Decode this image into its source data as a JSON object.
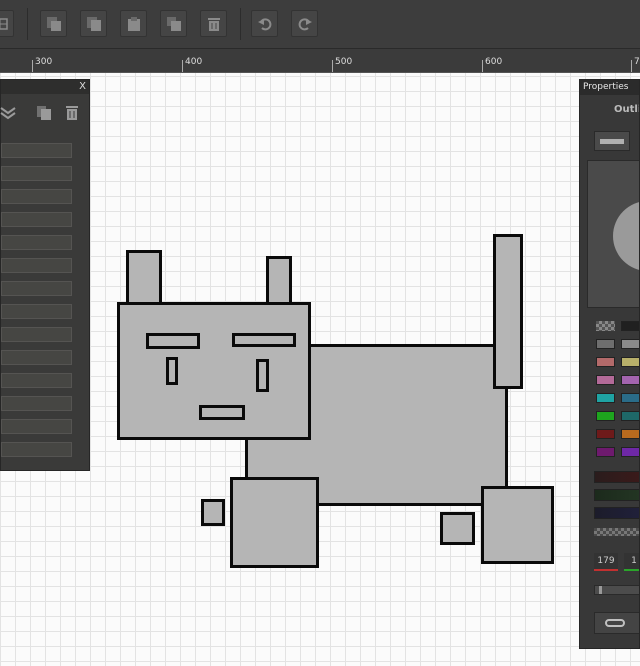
{
  "toolbar": {
    "icons": [
      "table-icon",
      "copy-icon",
      "duplicate-icon",
      "paste-icon",
      "clone-icon",
      "delete-icon",
      "undo-icon",
      "redo-icon"
    ]
  },
  "ruler": {
    "labels": [
      "300",
      "400",
      "500",
      "600",
      "7"
    ]
  },
  "left_panel": {
    "close_label": "X"
  },
  "properties": {
    "title": "Properties",
    "outline_label": "Outlin",
    "red_value": "179",
    "green_value": "1",
    "swatches": [
      "#3c3c3c",
      "#202020",
      "#6e6e6e",
      "#8a8a8a",
      "#b36a6a",
      "#b8b06a",
      "#b36a98",
      "#a364ae",
      "#1fa3a3",
      "#2a6c88",
      "#1ea51e",
      "#1e6868",
      "#6e1a1a",
      "#b86a1e",
      "#6e1a6e",
      "#6e28a6"
    ]
  }
}
